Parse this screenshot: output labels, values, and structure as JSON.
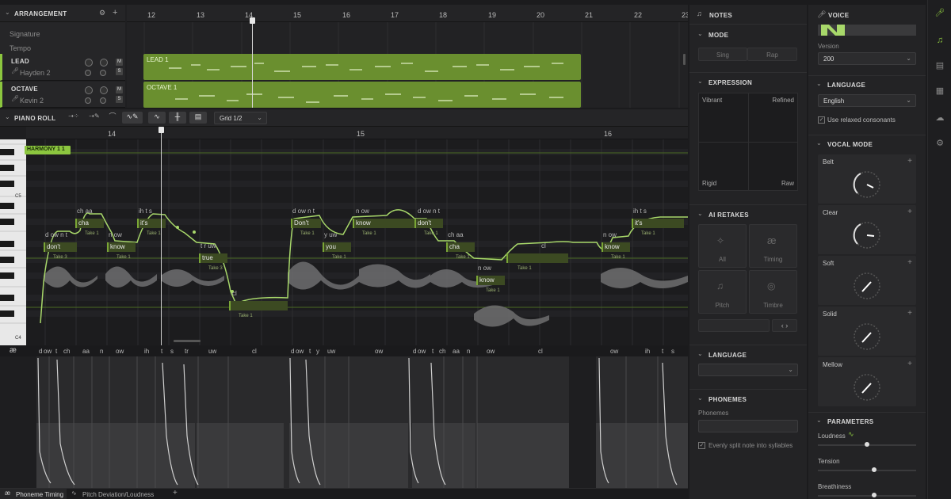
{
  "arrangement": {
    "title": "ARRANGEMENT",
    "bar_numbers": [
      "12",
      "13",
      "14",
      "15",
      "16",
      "17",
      "18",
      "19",
      "20",
      "21",
      "22",
      "23"
    ],
    "rows": [
      {
        "label": "Signature"
      },
      {
        "label": "Tempo"
      }
    ],
    "tracks": [
      {
        "name": "LEAD",
        "voice": "Hayden 2",
        "clip": "LEAD 1"
      },
      {
        "name": "OCTAVE",
        "voice": "Kevin 2",
        "clip": "OCTAVE 1"
      }
    ],
    "mute_label": "M",
    "solo_label": "S"
  },
  "piano_roll": {
    "title": "PIANO ROLL",
    "grid": "Grid 1/2",
    "bar_numbers": [
      "14",
      "15",
      "16"
    ],
    "clip_label": "HARMONY 1 1",
    "key_labels": [
      "C5",
      "C4"
    ],
    "notes": [
      {
        "phon": "d ow n t",
        "lyric": "don't",
        "take": "Take 3"
      },
      {
        "phon": "ch aa",
        "lyric": "cha",
        "take": "Take 1"
      },
      {
        "phon": "n ow",
        "lyric": "know",
        "take": "Take 1"
      },
      {
        "phon": "ih t s",
        "lyric": "it's",
        "take": "Take 1"
      },
      {
        "phon": "t r uw",
        "lyric": "true",
        "take": "Take 3"
      },
      {
        "phon": "cl",
        "lyric": "",
        "take": "Take 1"
      },
      {
        "phon": "d ow n t",
        "lyric": "Don't",
        "take": "Take 1"
      },
      {
        "phon": "y uw",
        "lyric": "you",
        "take": "Take 1"
      },
      {
        "phon": "n ow",
        "lyric": "know",
        "take": "Take 1"
      },
      {
        "phon": "d ow n t",
        "lyric": "don't",
        "take": "Take 1"
      },
      {
        "phon": "ch aa",
        "lyric": "cha",
        "take": "Take 1"
      },
      {
        "phon": "n ow",
        "lyric": "know",
        "take": "Take 1"
      },
      {
        "phon": "cl",
        "lyric": "",
        "take": "Take 1"
      },
      {
        "phon": "n ow",
        "lyric": "know",
        "take": "Take 1"
      },
      {
        "phon": "ih t s",
        "lyric": "it's",
        "take": "Take 1"
      }
    ]
  },
  "phoneme_strip": {
    "symbol": "æ",
    "labels": [
      "d",
      "ow",
      "t",
      "ch",
      "aa",
      "n",
      "ow",
      "ih",
      "t",
      "s",
      "tr",
      "uw",
      "cl",
      "d",
      "ow",
      "t",
      "y",
      "uw",
      "ow",
      "d",
      "ow",
      "t",
      "ch",
      "aa",
      "n",
      "ow",
      "cl",
      "ow",
      "ih",
      "t",
      "s"
    ]
  },
  "bottom_tabs": [
    {
      "label": "Phoneme Timing"
    },
    {
      "label": "Pitch Deviation/Loudness"
    }
  ],
  "add_tab": "+",
  "notes_panel": {
    "title": "NOTES",
    "mode": {
      "title": "MODE",
      "options": [
        "Sing",
        "Rap"
      ]
    },
    "expression": {
      "title": "EXPRESSION",
      "corners": [
        "Vibrant",
        "Refined",
        "Rigid",
        "Raw"
      ]
    },
    "ai_retakes": {
      "title": "AI RETAKES",
      "buttons": [
        "All",
        "Timing",
        "Pitch",
        "Timbre"
      ]
    },
    "language": {
      "title": "LANGUAGE"
    },
    "phonemes": {
      "title": "PHONEMES",
      "field_label": "Phonemes",
      "checkbox": "Evenly split note into syllables"
    }
  },
  "voice_panel": {
    "title": "VOICE",
    "version_label": "Version",
    "version_value": "200",
    "language_title": "LANGUAGE",
    "language_value": "English",
    "relaxed_label": "Use relaxed consonants",
    "vocal_mode_title": "VOCAL MODE",
    "modes": [
      {
        "label": "Belt",
        "level": 0.6
      },
      {
        "label": "Clear",
        "level": 0.6
      },
      {
        "label": "Soft",
        "level": 0.3
      },
      {
        "label": "Solid",
        "level": 0.3
      },
      {
        "label": "Mellow",
        "level": 0.3
      }
    ],
    "parameters_title": "PARAMETERS",
    "parameters": [
      {
        "label": "Loudness",
        "value": 0.5
      },
      {
        "label": "Tension",
        "value": 0.5
      },
      {
        "label": "Breathiness",
        "value": 0.5
      }
    ]
  },
  "colors": {
    "accent": "#8cc63f",
    "clip": "#6a8f2f",
    "panel": "#232325"
  }
}
